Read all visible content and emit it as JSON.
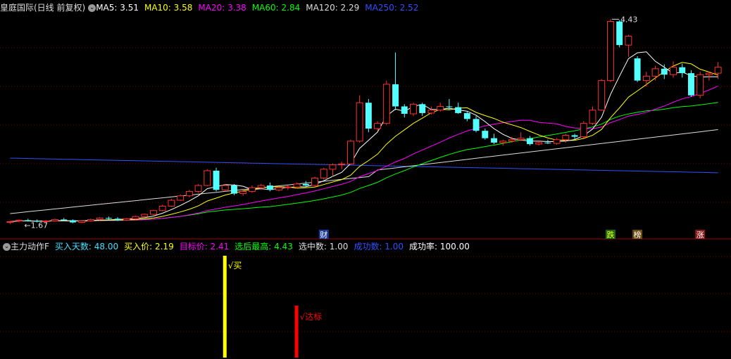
{
  "main_legend": {
    "stock": "皇庭国际(日线 前复权)",
    "items": [
      {
        "label": "MA5:",
        "value": "3.51",
        "color": "#ffffff"
      },
      {
        "label": "MA10:",
        "value": "3.58",
        "color": "#ffff00"
      },
      {
        "label": "MA20:",
        "value": "3.38",
        "color": "#ff00ff"
      },
      {
        "label": "MA60:",
        "value": "2.84",
        "color": "#00ff00"
      },
      {
        "label": "MA120:",
        "value": "2.29",
        "color": "#dddddd"
      },
      {
        "label": "MA250:",
        "value": "2.52",
        "color": "#3050ff"
      }
    ]
  },
  "sub_legend": {
    "name": "主力动作F",
    "items": [
      {
        "label": "买入天数:",
        "value": "48.00",
        "color": "#40e0ff"
      },
      {
        "label": "买入价:",
        "value": "2.19",
        "color": "#ffff00"
      },
      {
        "label": "目标价:",
        "value": "2.41",
        "color": "#ff00ff"
      },
      {
        "label": "选后最高:",
        "value": "4.43",
        "color": "#00ff00"
      },
      {
        "label": "选中数:",
        "value": "1.00",
        "color": "#dddddd"
      },
      {
        "label": "成功数:",
        "value": "1.00",
        "color": "#3050ff"
      },
      {
        "label": "成功率:",
        "value": "100.00",
        "color": "#ffffff"
      }
    ]
  },
  "annotations": {
    "high_label": "4.43",
    "low_label": "←1.67",
    "buy_signal": "买",
    "target_signal": "达标"
  },
  "badges": [
    {
      "text": "财",
      "bg": "#1a3a9a",
      "color": "#ffffff"
    },
    {
      "text": "跌",
      "bg": "#1a6a1a",
      "color": "#ffff00"
    },
    {
      "text": "榜",
      "bg": "#6a4a10",
      "color": "#ffffff"
    },
    {
      "text": "涨",
      "bg": "#8a1a1a",
      "color": "#ffffff"
    }
  ],
  "colors": {
    "up": "#ff3030",
    "down": "#54ffff",
    "grid": "#800000",
    "buy_bar": "#ffff00",
    "target_bar": "#ff0000"
  },
  "chart_data": {
    "type": "candlestick",
    "x_axis": "trading day",
    "price_range": [
      1.6,
      4.5
    ],
    "candles": [
      [
        1.68,
        1.7,
        1.66,
        1.69
      ],
      [
        1.7,
        1.72,
        1.68,
        1.71
      ],
      [
        1.71,
        1.73,
        1.69,
        1.7
      ],
      [
        1.7,
        1.72,
        1.68,
        1.69
      ],
      [
        1.69,
        1.71,
        1.67,
        1.7
      ],
      [
        1.7,
        1.73,
        1.69,
        1.72
      ],
      [
        1.72,
        1.74,
        1.7,
        1.71
      ],
      [
        1.71,
        1.72,
        1.67,
        1.68
      ],
      [
        1.68,
        1.71,
        1.67,
        1.7
      ],
      [
        1.7,
        1.73,
        1.69,
        1.72
      ],
      [
        1.72,
        1.75,
        1.71,
        1.74
      ],
      [
        1.74,
        1.76,
        1.72,
        1.73
      ],
      [
        1.73,
        1.75,
        1.7,
        1.71
      ],
      [
        1.71,
        1.74,
        1.7,
        1.73
      ],
      [
        1.73,
        1.77,
        1.72,
        1.76
      ],
      [
        1.76,
        1.8,
        1.75,
        1.79
      ],
      [
        1.79,
        1.85,
        1.78,
        1.84
      ],
      [
        1.84,
        1.92,
        1.83,
        1.9
      ],
      [
        1.9,
        2.0,
        1.89,
        1.98
      ],
      [
        1.98,
        2.06,
        1.97,
        2.04
      ],
      [
        2.04,
        2.12,
        2.02,
        2.1
      ],
      [
        2.1,
        2.2,
        2.08,
        2.18
      ],
      [
        2.18,
        2.4,
        2.17,
        2.38
      ],
      [
        2.38,
        2.42,
        2.1,
        2.12
      ],
      [
        2.12,
        2.2,
        2.1,
        2.18
      ],
      [
        2.18,
        2.2,
        2.05,
        2.07
      ],
      [
        2.07,
        2.12,
        2.04,
        2.1
      ],
      [
        2.1,
        2.18,
        2.08,
        2.15
      ],
      [
        2.15,
        2.2,
        2.12,
        2.18
      ],
      [
        2.18,
        2.22,
        2.1,
        2.12
      ],
      [
        2.12,
        2.17,
        2.1,
        2.15
      ],
      [
        2.15,
        2.18,
        2.12,
        2.16
      ],
      [
        2.16,
        2.22,
        2.14,
        2.2
      ],
      [
        2.2,
        2.24,
        2.16,
        2.18
      ],
      [
        2.18,
        2.3,
        2.16,
        2.28
      ],
      [
        2.28,
        2.42,
        2.26,
        2.4
      ],
      [
        2.4,
        2.48,
        2.3,
        2.46
      ],
      [
        2.46,
        2.5,
        2.4,
        2.47
      ],
      [
        2.47,
        2.8,
        2.46,
        2.78
      ],
      [
        2.78,
        3.4,
        2.76,
        3.3
      ],
      [
        3.3,
        3.35,
        2.9,
        2.95
      ],
      [
        2.95,
        3.05,
        2.92,
        3.02
      ],
      [
        3.02,
        3.6,
        3.0,
        3.55
      ],
      [
        3.55,
        3.98,
        3.2,
        3.25
      ],
      [
        3.25,
        3.28,
        3.1,
        3.15
      ],
      [
        3.15,
        3.3,
        3.12,
        3.28
      ],
      [
        3.28,
        3.3,
        3.12,
        3.16
      ],
      [
        3.16,
        3.25,
        3.14,
        3.2
      ],
      [
        3.2,
        3.3,
        3.18,
        3.25
      ],
      [
        3.25,
        3.35,
        3.2,
        3.24
      ],
      [
        3.24,
        3.3,
        3.15,
        3.16
      ],
      [
        3.16,
        3.18,
        3.05,
        3.08
      ],
      [
        3.08,
        3.12,
        2.9,
        2.92
      ],
      [
        2.92,
        2.95,
        2.8,
        2.82
      ],
      [
        2.82,
        2.88,
        2.74,
        2.76
      ],
      [
        2.76,
        2.8,
        2.72,
        2.78
      ],
      [
        2.78,
        2.84,
        2.76,
        2.8
      ],
      [
        2.8,
        2.9,
        2.78,
        2.82
      ],
      [
        2.82,
        2.85,
        2.72,
        2.74
      ],
      [
        2.74,
        2.78,
        2.72,
        2.76
      ],
      [
        2.76,
        2.8,
        2.74,
        2.75
      ],
      [
        2.75,
        2.82,
        2.73,
        2.8
      ],
      [
        2.8,
        2.88,
        2.76,
        2.86
      ],
      [
        2.86,
        2.88,
        2.8,
        2.84
      ],
      [
        2.84,
        3.05,
        2.82,
        3.02
      ],
      [
        3.02,
        3.25,
        3.0,
        3.2
      ],
      [
        3.2,
        3.62,
        3.19,
        3.6
      ],
      [
        3.6,
        4.43,
        3.58,
        4.4
      ],
      [
        4.4,
        4.42,
        4.05,
        4.08
      ],
      [
        4.08,
        4.22,
        3.92,
        4.2
      ],
      [
        3.9,
        3.93,
        3.58,
        3.6
      ],
      [
        3.6,
        3.72,
        3.52,
        3.66
      ],
      [
        3.66,
        3.8,
        3.6,
        3.76
      ],
      [
        3.76,
        3.82,
        3.62,
        3.68
      ],
      [
        3.68,
        3.86,
        3.64,
        3.78
      ],
      [
        3.78,
        3.83,
        3.64,
        3.7
      ],
      [
        3.7,
        3.74,
        3.38,
        3.4
      ],
      [
        3.4,
        3.72,
        3.36,
        3.68
      ],
      [
        3.68,
        3.72,
        3.6,
        3.7
      ],
      [
        3.7,
        3.85,
        3.62,
        3.78
      ]
    ]
  }
}
